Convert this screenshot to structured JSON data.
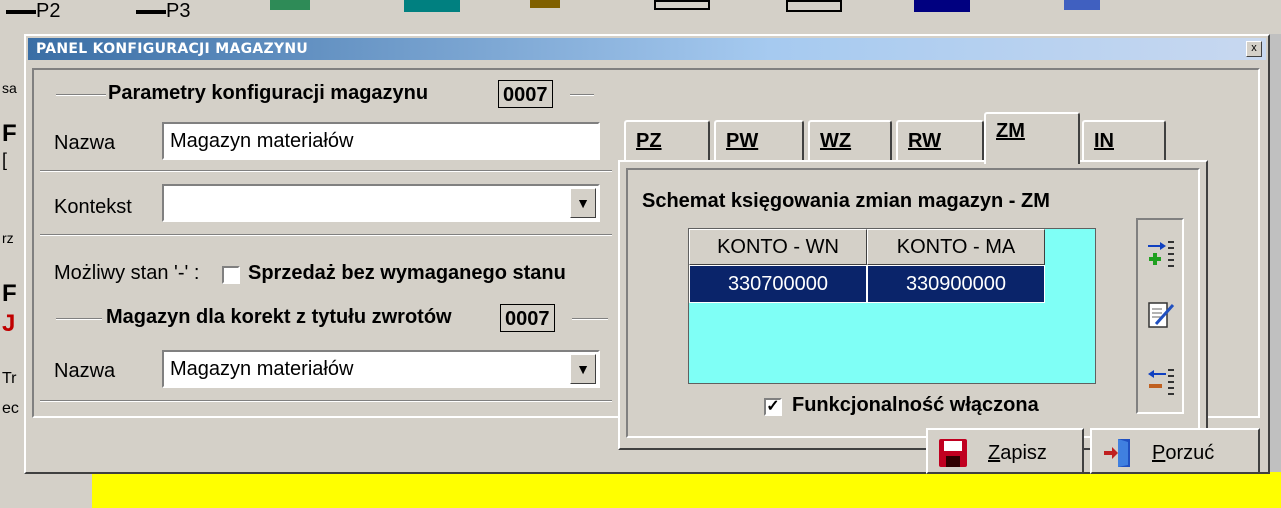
{
  "background": {
    "toolbar_items": [
      "P2",
      "P3"
    ],
    "left_fragments": [
      "sa",
      "F",
      "[",
      "rz",
      "F",
      "J",
      "Tr",
      "ec"
    ]
  },
  "dialog": {
    "title": "PANEL KONFIGURACJI MAGAZYNU",
    "close_label": "x",
    "params": {
      "title": "Parametry konfiguracji  magazynu",
      "code": "0007",
      "name_label": "Nazwa",
      "name_value": "Magazyn materiałów",
      "context_label": "Kontekst",
      "context_value": "",
      "stan_label": "Możliwy stan '-' :",
      "stan_checked": false,
      "stan_text": "Sprzedaż bez wymaganego stanu"
    },
    "returns": {
      "title": "Magazyn dla korekt z tytułu zwrotów",
      "code": "0007",
      "name_label": "Nazwa",
      "name_value": "Magazyn materiałów"
    },
    "tabs": [
      {
        "label": "PZ",
        "active": false
      },
      {
        "label": "PW",
        "active": false
      },
      {
        "label": "WZ",
        "active": false
      },
      {
        "label": "RW",
        "active": false
      },
      {
        "label": "ZM",
        "active": true
      },
      {
        "label": "IN",
        "active": false
      }
    ],
    "schema": {
      "title": "Schemat  księgowania  zmian magazyn  - ZM",
      "columns": [
        "KONTO - WN",
        "KONTO - MA"
      ],
      "rows": [
        [
          "330700000",
          "330900000"
        ]
      ],
      "enabled_label": "Funkcjonalność włączona",
      "enabled_checked": true
    },
    "buttons": {
      "save": {
        "prefix": "Z",
        "rest": "apisz"
      },
      "cancel": {
        "prefix": "P",
        "rest": "orzuć"
      }
    }
  },
  "colors": {
    "grid_bg": "#7ffff6",
    "selection": "#0a246a",
    "title_gradient_start": "#3a6ea5",
    "yellow_bg": "#ffff00"
  }
}
